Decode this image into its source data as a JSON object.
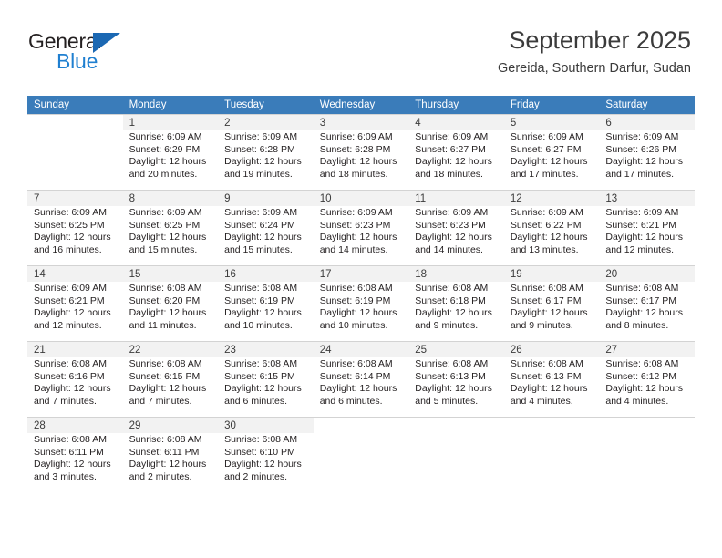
{
  "brand": {
    "name_part1": "General",
    "name_part2": "Blue",
    "accent_color": "#1f7fd0",
    "triangle_color": "#1b68b3"
  },
  "header": {
    "title": "September 2025",
    "subtitle": "Gereida, Southern Darfur, Sudan"
  },
  "calendar": {
    "header_bg": "#3a7cba",
    "weekday_headers": [
      "Sunday",
      "Monday",
      "Tuesday",
      "Wednesday",
      "Thursday",
      "Friday",
      "Saturday"
    ],
    "weeks": [
      [
        {
          "day": "",
          "sunrise": "",
          "sunset": "",
          "daylight_line1": "",
          "daylight_line2": ""
        },
        {
          "day": "1",
          "sunrise": "Sunrise: 6:09 AM",
          "sunset": "Sunset: 6:29 PM",
          "daylight_line1": "Daylight: 12 hours",
          "daylight_line2": "and 20 minutes."
        },
        {
          "day": "2",
          "sunrise": "Sunrise: 6:09 AM",
          "sunset": "Sunset: 6:28 PM",
          "daylight_line1": "Daylight: 12 hours",
          "daylight_line2": "and 19 minutes."
        },
        {
          "day": "3",
          "sunrise": "Sunrise: 6:09 AM",
          "sunset": "Sunset: 6:28 PM",
          "daylight_line1": "Daylight: 12 hours",
          "daylight_line2": "and 18 minutes."
        },
        {
          "day": "4",
          "sunrise": "Sunrise: 6:09 AM",
          "sunset": "Sunset: 6:27 PM",
          "daylight_line1": "Daylight: 12 hours",
          "daylight_line2": "and 18 minutes."
        },
        {
          "day": "5",
          "sunrise": "Sunrise: 6:09 AM",
          "sunset": "Sunset: 6:27 PM",
          "daylight_line1": "Daylight: 12 hours",
          "daylight_line2": "and 17 minutes."
        },
        {
          "day": "6",
          "sunrise": "Sunrise: 6:09 AM",
          "sunset": "Sunset: 6:26 PM",
          "daylight_line1": "Daylight: 12 hours",
          "daylight_line2": "and 17 minutes."
        }
      ],
      [
        {
          "day": "7",
          "sunrise": "Sunrise: 6:09 AM",
          "sunset": "Sunset: 6:25 PM",
          "daylight_line1": "Daylight: 12 hours",
          "daylight_line2": "and 16 minutes."
        },
        {
          "day": "8",
          "sunrise": "Sunrise: 6:09 AM",
          "sunset": "Sunset: 6:25 PM",
          "daylight_line1": "Daylight: 12 hours",
          "daylight_line2": "and 15 minutes."
        },
        {
          "day": "9",
          "sunrise": "Sunrise: 6:09 AM",
          "sunset": "Sunset: 6:24 PM",
          "daylight_line1": "Daylight: 12 hours",
          "daylight_line2": "and 15 minutes."
        },
        {
          "day": "10",
          "sunrise": "Sunrise: 6:09 AM",
          "sunset": "Sunset: 6:23 PM",
          "daylight_line1": "Daylight: 12 hours",
          "daylight_line2": "and 14 minutes."
        },
        {
          "day": "11",
          "sunrise": "Sunrise: 6:09 AM",
          "sunset": "Sunset: 6:23 PM",
          "daylight_line1": "Daylight: 12 hours",
          "daylight_line2": "and 14 minutes."
        },
        {
          "day": "12",
          "sunrise": "Sunrise: 6:09 AM",
          "sunset": "Sunset: 6:22 PM",
          "daylight_line1": "Daylight: 12 hours",
          "daylight_line2": "and 13 minutes."
        },
        {
          "day": "13",
          "sunrise": "Sunrise: 6:09 AM",
          "sunset": "Sunset: 6:21 PM",
          "daylight_line1": "Daylight: 12 hours",
          "daylight_line2": "and 12 minutes."
        }
      ],
      [
        {
          "day": "14",
          "sunrise": "Sunrise: 6:09 AM",
          "sunset": "Sunset: 6:21 PM",
          "daylight_line1": "Daylight: 12 hours",
          "daylight_line2": "and 12 minutes."
        },
        {
          "day": "15",
          "sunrise": "Sunrise: 6:08 AM",
          "sunset": "Sunset: 6:20 PM",
          "daylight_line1": "Daylight: 12 hours",
          "daylight_line2": "and 11 minutes."
        },
        {
          "day": "16",
          "sunrise": "Sunrise: 6:08 AM",
          "sunset": "Sunset: 6:19 PM",
          "daylight_line1": "Daylight: 12 hours",
          "daylight_line2": "and 10 minutes."
        },
        {
          "day": "17",
          "sunrise": "Sunrise: 6:08 AM",
          "sunset": "Sunset: 6:19 PM",
          "daylight_line1": "Daylight: 12 hours",
          "daylight_line2": "and 10 minutes."
        },
        {
          "day": "18",
          "sunrise": "Sunrise: 6:08 AM",
          "sunset": "Sunset: 6:18 PM",
          "daylight_line1": "Daylight: 12 hours",
          "daylight_line2": "and 9 minutes."
        },
        {
          "day": "19",
          "sunrise": "Sunrise: 6:08 AM",
          "sunset": "Sunset: 6:17 PM",
          "daylight_line1": "Daylight: 12 hours",
          "daylight_line2": "and 9 minutes."
        },
        {
          "day": "20",
          "sunrise": "Sunrise: 6:08 AM",
          "sunset": "Sunset: 6:17 PM",
          "daylight_line1": "Daylight: 12 hours",
          "daylight_line2": "and 8 minutes."
        }
      ],
      [
        {
          "day": "21",
          "sunrise": "Sunrise: 6:08 AM",
          "sunset": "Sunset: 6:16 PM",
          "daylight_line1": "Daylight: 12 hours",
          "daylight_line2": "and 7 minutes."
        },
        {
          "day": "22",
          "sunrise": "Sunrise: 6:08 AM",
          "sunset": "Sunset: 6:15 PM",
          "daylight_line1": "Daylight: 12 hours",
          "daylight_line2": "and 7 minutes."
        },
        {
          "day": "23",
          "sunrise": "Sunrise: 6:08 AM",
          "sunset": "Sunset: 6:15 PM",
          "daylight_line1": "Daylight: 12 hours",
          "daylight_line2": "and 6 minutes."
        },
        {
          "day": "24",
          "sunrise": "Sunrise: 6:08 AM",
          "sunset": "Sunset: 6:14 PM",
          "daylight_line1": "Daylight: 12 hours",
          "daylight_line2": "and 6 minutes."
        },
        {
          "day": "25",
          "sunrise": "Sunrise: 6:08 AM",
          "sunset": "Sunset: 6:13 PM",
          "daylight_line1": "Daylight: 12 hours",
          "daylight_line2": "and 5 minutes."
        },
        {
          "day": "26",
          "sunrise": "Sunrise: 6:08 AM",
          "sunset": "Sunset: 6:13 PM",
          "daylight_line1": "Daylight: 12 hours",
          "daylight_line2": "and 4 minutes."
        },
        {
          "day": "27",
          "sunrise": "Sunrise: 6:08 AM",
          "sunset": "Sunset: 6:12 PM",
          "daylight_line1": "Daylight: 12 hours",
          "daylight_line2": "and 4 minutes."
        }
      ],
      [
        {
          "day": "28",
          "sunrise": "Sunrise: 6:08 AM",
          "sunset": "Sunset: 6:11 PM",
          "daylight_line1": "Daylight: 12 hours",
          "daylight_line2": "and 3 minutes."
        },
        {
          "day": "29",
          "sunrise": "Sunrise: 6:08 AM",
          "sunset": "Sunset: 6:11 PM",
          "daylight_line1": "Daylight: 12 hours",
          "daylight_line2": "and 2 minutes."
        },
        {
          "day": "30",
          "sunrise": "Sunrise: 6:08 AM",
          "sunset": "Sunset: 6:10 PM",
          "daylight_line1": "Daylight: 12 hours",
          "daylight_line2": "and 2 minutes."
        },
        {
          "day": "",
          "sunrise": "",
          "sunset": "",
          "daylight_line1": "",
          "daylight_line2": ""
        },
        {
          "day": "",
          "sunrise": "",
          "sunset": "",
          "daylight_line1": "",
          "daylight_line2": ""
        },
        {
          "day": "",
          "sunrise": "",
          "sunset": "",
          "daylight_line1": "",
          "daylight_line2": ""
        },
        {
          "day": "",
          "sunrise": "",
          "sunset": "",
          "daylight_line1": "",
          "daylight_line2": ""
        }
      ]
    ]
  }
}
